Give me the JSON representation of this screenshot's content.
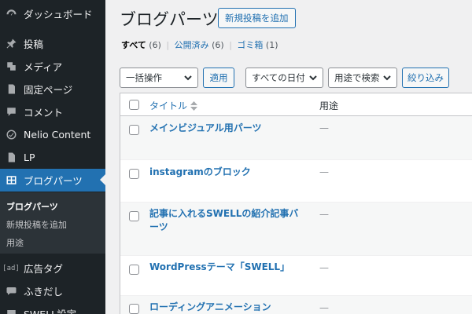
{
  "sidebar": {
    "items": [
      {
        "label": "ダッシュボード",
        "icon": "dashboard-icon"
      },
      {
        "label": "投稿",
        "icon": "pin-icon"
      },
      {
        "label": "メディア",
        "icon": "media-icon"
      },
      {
        "label": "固定ページ",
        "icon": "page-icon"
      },
      {
        "label": "コメント",
        "icon": "comment-icon"
      },
      {
        "label": "Nelio Content",
        "icon": "nelio-icon"
      },
      {
        "label": "LP",
        "icon": "document-icon"
      },
      {
        "label": "ブログパーツ",
        "icon": "blog-parts-icon"
      },
      {
        "label": "広告タグ",
        "icon": "ad-icon",
        "icon_text": "[ad]"
      },
      {
        "label": "ふきだし",
        "icon": "speech-bubble-icon"
      },
      {
        "label": "SWELL設定",
        "icon": "settings-icon"
      }
    ],
    "submenu": [
      "ブログパーツ",
      "新規投稿を追加",
      "用途"
    ]
  },
  "header": {
    "title": "ブログパーツ",
    "add_new": "新規投稿を追加"
  },
  "views": {
    "all_label": "すべて",
    "all_count": "(6)",
    "published_label": "公開済み",
    "published_count": "(6)",
    "trash_label": "ゴミ箱",
    "trash_count": "(1)",
    "separator": "|"
  },
  "filters": {
    "bulk_action": "一括操作",
    "apply": "適用",
    "all_dates": "すべての日付",
    "usage_filter": "用途で検索",
    "filter_button": "絞り込み"
  },
  "table": {
    "columns": [
      "タイトル",
      "用途"
    ],
    "rows": [
      {
        "title": "メインビジュアル用パーツ",
        "usage": "—"
      },
      {
        "title": "instagramのブロック",
        "usage": "—"
      },
      {
        "title": "記事に入れるSWELLの紹介記事バーツ",
        "usage": "—"
      },
      {
        "title": "WordPressテーマ「SWELL」",
        "usage": "—"
      },
      {
        "title": "ローディングアニメーション",
        "usage": "—"
      }
    ]
  },
  "colors": {
    "sidebar_bg": "#1d2327",
    "accent": "#2271b1",
    "page_bg": "#f0f0f1"
  }
}
